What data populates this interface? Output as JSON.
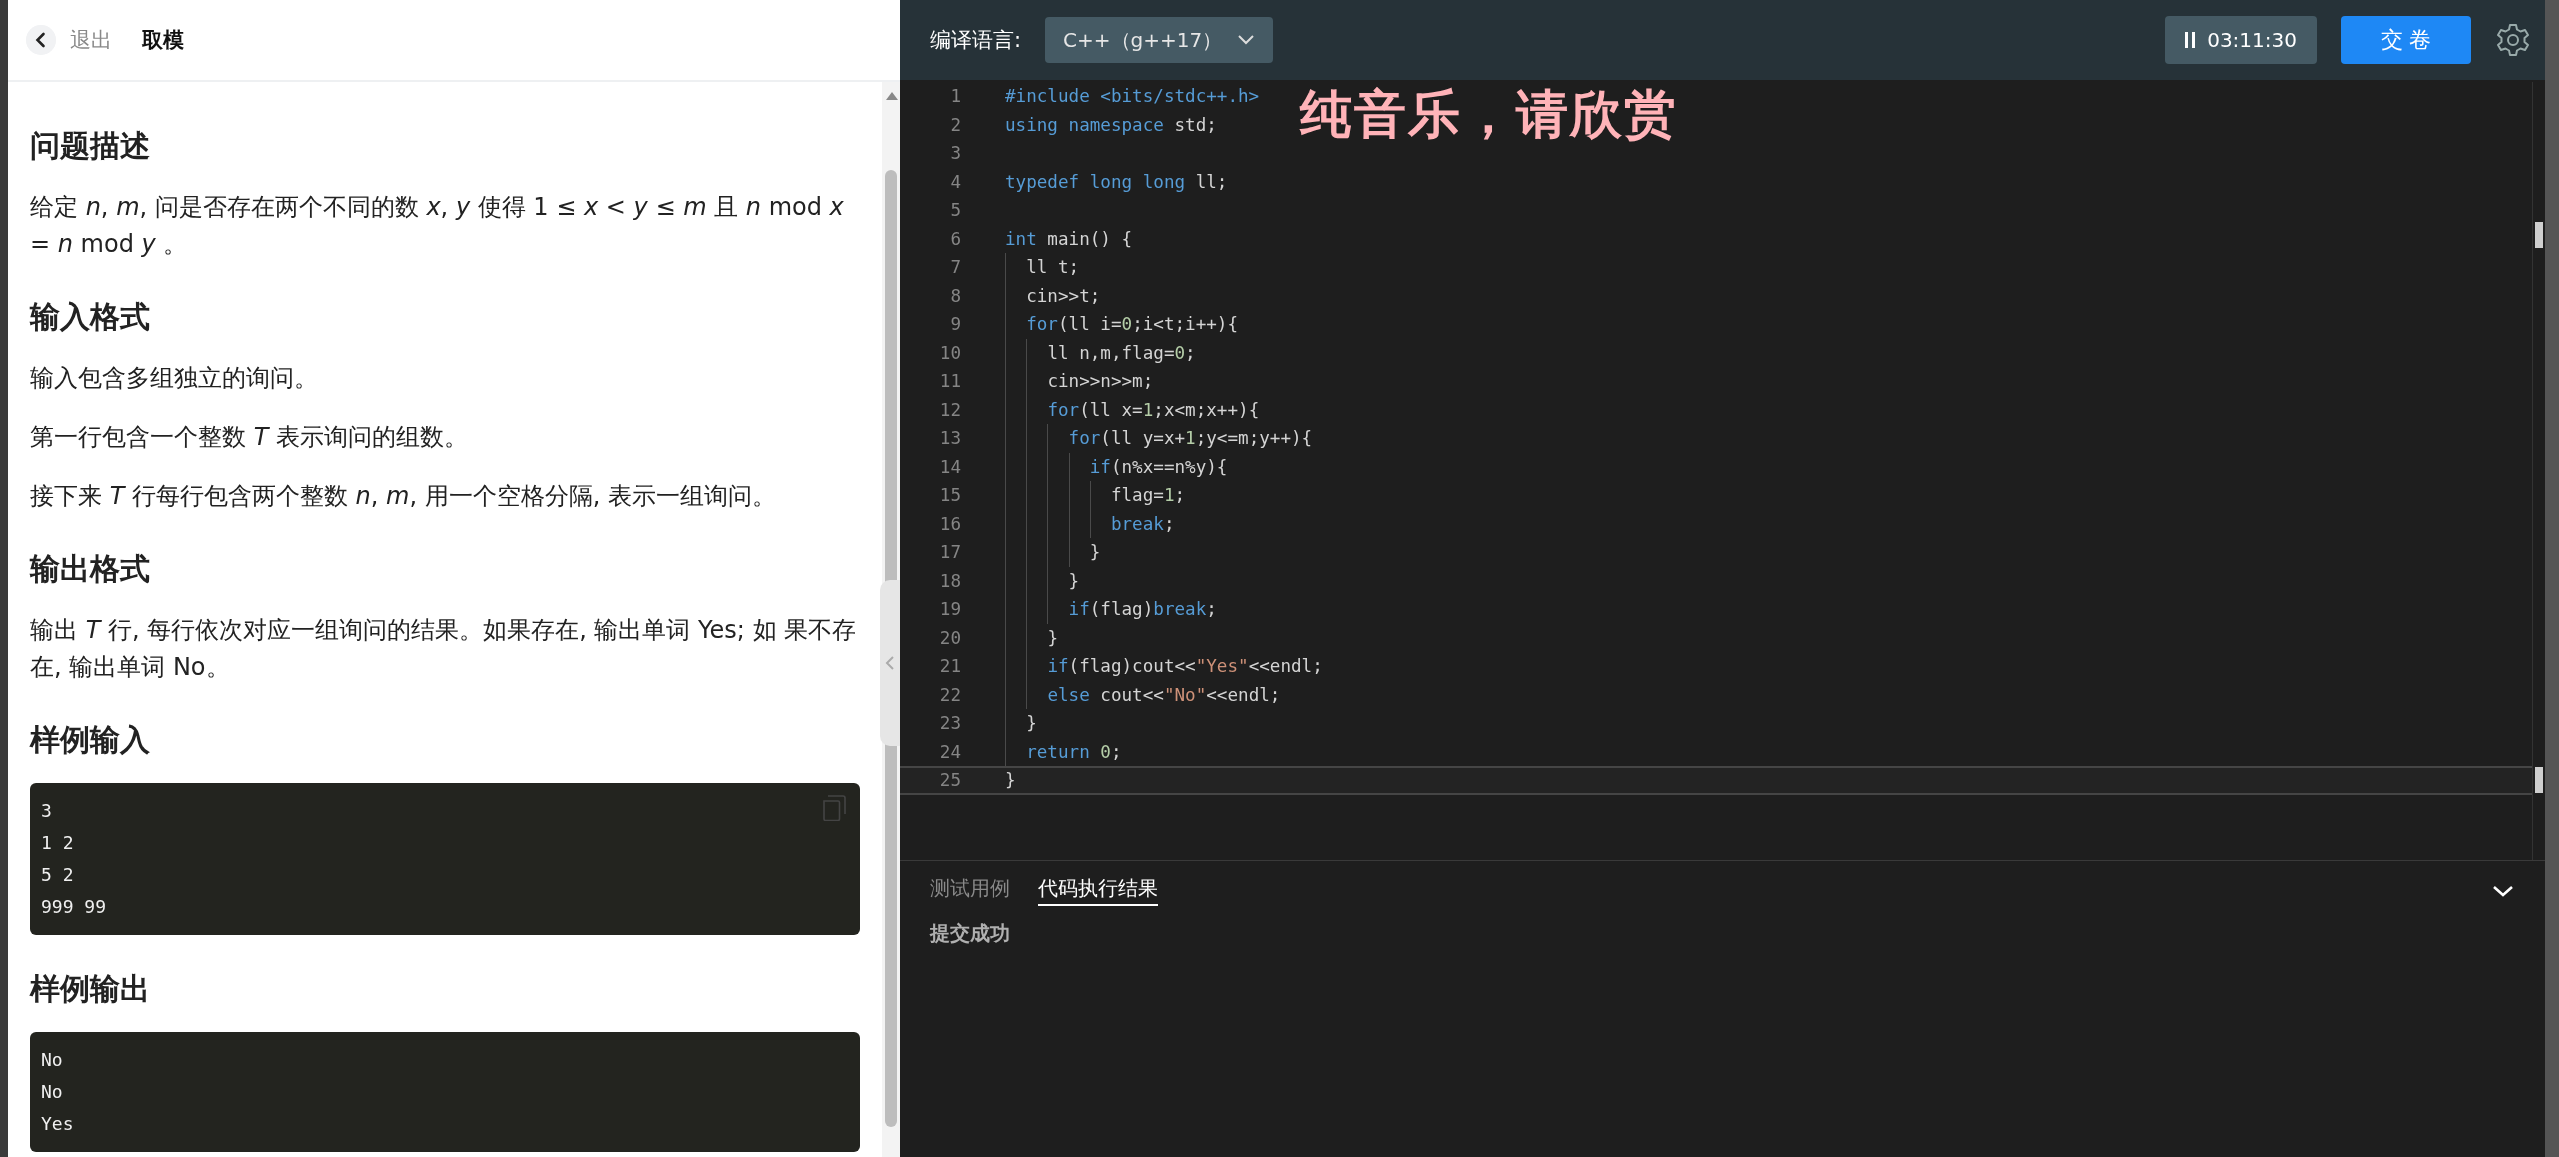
{
  "problem_panel": {
    "back_label": "退出",
    "title": "取模",
    "sections": [
      {
        "heading": "问题描述",
        "paragraphs": [
          "给定 *n*, *m*, 问是否存在两个不同的数 *x*, *y* 使得 1 ≤ *x* < *y* ≤ *m* 且 *n* mod *x* = *n* mod *y* 。"
        ]
      },
      {
        "heading": "输入格式",
        "paragraphs": [
          "输入包含多组独立的询问。",
          "第一行包含一个整数 *T* 表示询问的组数。",
          "接下来 *T* 行每行包含两个整数 *n*, *m*, 用一个空格分隔, 表示一组询问。"
        ]
      },
      {
        "heading": "输出格式",
        "paragraphs": [
          "输出 *T* 行, 每行依次对应一组询问的结果。如果存在, 输出单词 Yes; 如 果不存在, 输出单词 No。"
        ]
      },
      {
        "heading": "样例输入",
        "sample": [
          "3",
          "1 2",
          "5 2",
          "999 99"
        ]
      },
      {
        "heading": "样例输出",
        "sample": [
          "No",
          "No",
          "Yes"
        ]
      }
    ]
  },
  "toolbar": {
    "language_label": "编译语言:",
    "language": "C++（g++17）",
    "timer": "03:11:30",
    "submit": "交 卷"
  },
  "overlay_caption": "纯音乐，请欣赏",
  "editor": {
    "lines": [
      {
        "number": "1",
        "current": false,
        "tokens": [
          {
            "kind": "keyword",
            "text": "#include <bits/stdc++.h>"
          }
        ]
      },
      {
        "number": "2",
        "current": false,
        "tokens": [
          {
            "kind": "keyword",
            "text": "using namespace"
          },
          {
            "kind": "plain",
            "text": " std;"
          }
        ]
      },
      {
        "number": "3",
        "current": false
      },
      {
        "number": "4",
        "current": false,
        "tokens": [
          {
            "kind": "keyword",
            "text": "typedef long long"
          },
          {
            "kind": "plain",
            "text": " ll;"
          }
        ]
      },
      {
        "number": "5",
        "current": false
      },
      {
        "number": "6",
        "current": false,
        "tokens": [
          {
            "kind": "keyword",
            "text": "int"
          },
          {
            "kind": "plain",
            "text": " main() {"
          }
        ]
      },
      {
        "number": "7",
        "current": false,
        "tokens": [
          {
            "kind": "plain",
            "text": "  ll t;"
          }
        ]
      },
      {
        "number": "8",
        "current": false,
        "tokens": [
          {
            "kind": "plain",
            "text": "  cin>>t;"
          }
        ]
      },
      {
        "number": "9",
        "current": false,
        "tokens": [
          {
            "kind": "keyword",
            "text": "  for"
          },
          {
            "kind": "plain",
            "text": "(ll i="
          },
          {
            "kind": "number",
            "text": "0"
          },
          {
            "kind": "plain",
            "text": ";i<t;i++){"
          }
        ]
      },
      {
        "number": "10",
        "current": false,
        "tokens": [
          {
            "kind": "plain",
            "text": "    ll n,m,flag="
          },
          {
            "kind": "number",
            "text": "0"
          },
          {
            "kind": "plain",
            "text": ";"
          }
        ]
      },
      {
        "number": "11",
        "current": false,
        "tokens": [
          {
            "kind": "plain",
            "text": "    cin>>n>>m;"
          }
        ]
      },
      {
        "number": "12",
        "current": false,
        "tokens": [
          {
            "kind": "keyword",
            "text": "    for"
          },
          {
            "kind": "plain",
            "text": "(ll x="
          },
          {
            "kind": "number",
            "text": "1"
          },
          {
            "kind": "plain",
            "text": ";x<m;x++){"
          }
        ]
      },
      {
        "number": "13",
        "current": false,
        "tokens": [
          {
            "kind": "keyword",
            "text": "      for"
          },
          {
            "kind": "plain",
            "text": "(ll y=x+"
          },
          {
            "kind": "number",
            "text": "1"
          },
          {
            "kind": "plain",
            "text": ";y<=m;y++){"
          }
        ]
      },
      {
        "number": "14",
        "current": false,
        "tokens": [
          {
            "kind": "keyword",
            "text": "        if"
          },
          {
            "kind": "plain",
            "text": "(n%x==n%y){"
          }
        ]
      },
      {
        "number": "15",
        "current": false,
        "tokens": [
          {
            "kind": "plain",
            "text": "          flag="
          },
          {
            "kind": "number",
            "text": "1"
          },
          {
            "kind": "plain",
            "text": ";"
          }
        ]
      },
      {
        "number": "16",
        "current": false,
        "tokens": [
          {
            "kind": "keyword",
            "text": "          break"
          },
          {
            "kind": "plain",
            "text": ";"
          }
        ]
      },
      {
        "number": "17",
        "current": false,
        "tokens": [
          {
            "kind": "plain",
            "text": "        }"
          }
        ]
      },
      {
        "number": "18",
        "current": false,
        "tokens": [
          {
            "kind": "plain",
            "text": "      }"
          }
        ]
      },
      {
        "number": "19",
        "current": false,
        "tokens": [
          {
            "kind": "keyword",
            "text": "      if"
          },
          {
            "kind": "plain",
            "text": "(flag)"
          },
          {
            "kind": "keyword",
            "text": "break"
          },
          {
            "kind": "plain",
            "text": ";"
          }
        ]
      },
      {
        "number": "20",
        "current": false,
        "tokens": [
          {
            "kind": "plain",
            "text": "    }"
          }
        ]
      },
      {
        "number": "21",
        "current": false,
        "tokens": [
          {
            "kind": "keyword",
            "text": "    if"
          },
          {
            "kind": "plain",
            "text": "(flag)cout<<"
          },
          {
            "kind": "string",
            "text": "\"Yes\""
          },
          {
            "kind": "plain",
            "text": "<<endl;"
          }
        ]
      },
      {
        "number": "22",
        "current": false,
        "tokens": [
          {
            "kind": "keyword",
            "text": "    else"
          },
          {
            "kind": "plain",
            "text": " cout<<"
          },
          {
            "kind": "string",
            "text": "\"No\""
          },
          {
            "kind": "plain",
            "text": "<<endl;"
          }
        ]
      },
      {
        "number": "23",
        "current": false,
        "tokens": [
          {
            "kind": "plain",
            "text": "  }"
          }
        ]
      },
      {
        "number": "24",
        "current": false,
        "tokens": [
          {
            "kind": "keyword",
            "text": "  return"
          },
          {
            "kind": "number",
            "text": " 0"
          },
          {
            "kind": "plain",
            "text": ";"
          }
        ]
      },
      {
        "number": "25",
        "current": true,
        "tokens": [
          {
            "kind": "plain",
            "text": "}"
          }
        ]
      }
    ]
  },
  "result_panel": {
    "tabs": [
      {
        "label": "测试用例",
        "selected": false
      },
      {
        "label": "代码执行结果",
        "selected": true
      }
    ],
    "message": "提交成功"
  }
}
